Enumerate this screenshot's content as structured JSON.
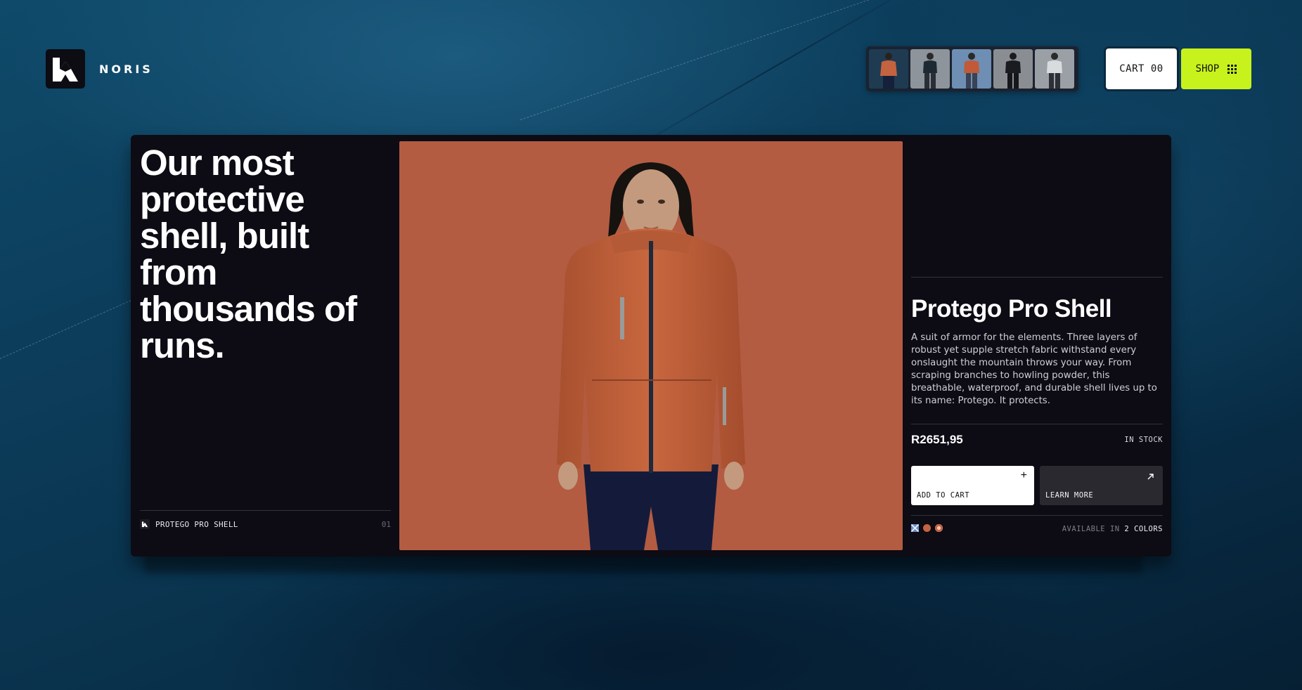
{
  "brand": {
    "name": "NORIS",
    "logo_icon": "noris-mountain-logo-icon"
  },
  "nav": {
    "thumbnails": [
      {
        "name": "jacket-orange-thumb",
        "active": true
      },
      {
        "name": "pants-grey-thumb",
        "active": false
      },
      {
        "name": "jacket-blue-thumb",
        "active": false
      },
      {
        "name": "jacket-black-thumb",
        "active": false
      },
      {
        "name": "jacket-light-grey-thumb",
        "active": false
      }
    ],
    "cart_label": "CART 00",
    "shop_label": "SHOP",
    "shop_icon": "grid-icon"
  },
  "hero": {
    "headline": "Our most protective shell, built from thousands of runs.",
    "footer_label": "PROTEGO PRO SHELL",
    "footer_index": "01"
  },
  "product": {
    "title": "Protego Pro Shell",
    "description": "A suit of armor for the elements. Three layers of robust yet supple stretch fabric withstand every onslaught the mountain throws your way. From scraping branches to howling powder, this breathable, waterproof, and durable shell lives up to its name: Protego. It protects.",
    "price": "R2651,95",
    "stock": "IN STOCK",
    "add_to_cart_label": "ADD TO CART",
    "learn_more_label": "LEARN MORE",
    "available_prefix": "AVAILABLE IN",
    "available_count": "2 COLORS",
    "colors": [
      "#6c8cc7",
      "#c4633f",
      "#c4633f"
    ]
  }
}
